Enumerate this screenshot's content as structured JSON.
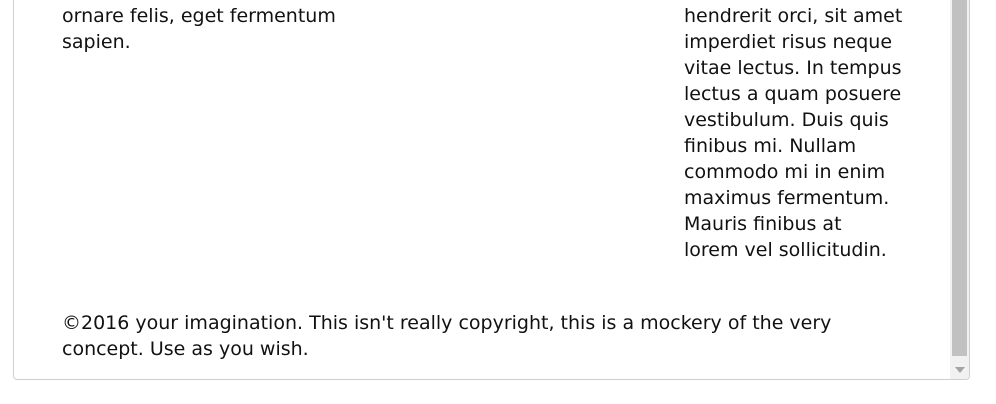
{
  "left_column": {
    "text": "commodo et a urna. Ut id\nornare felis, eget fermentum\nsapien."
  },
  "right_column": {
    "text": "augue neque\nhendrerit orci, sit amet\nimperdiet risus neque\nvitae lectus. In tempus\nlectus a quam posuere\nvestibulum. Duis quis\nfinibus mi. Nullam\ncommodo mi in enim\nmaximus fermentum.\nMauris finibus at\nlorem vel sollicitudin."
  },
  "footer": {
    "text": "©2016 your imagination. This isn't really copyright, this is a mockery of the very concept. Use as you wish."
  },
  "scrollbar": {
    "position": 0.93
  }
}
